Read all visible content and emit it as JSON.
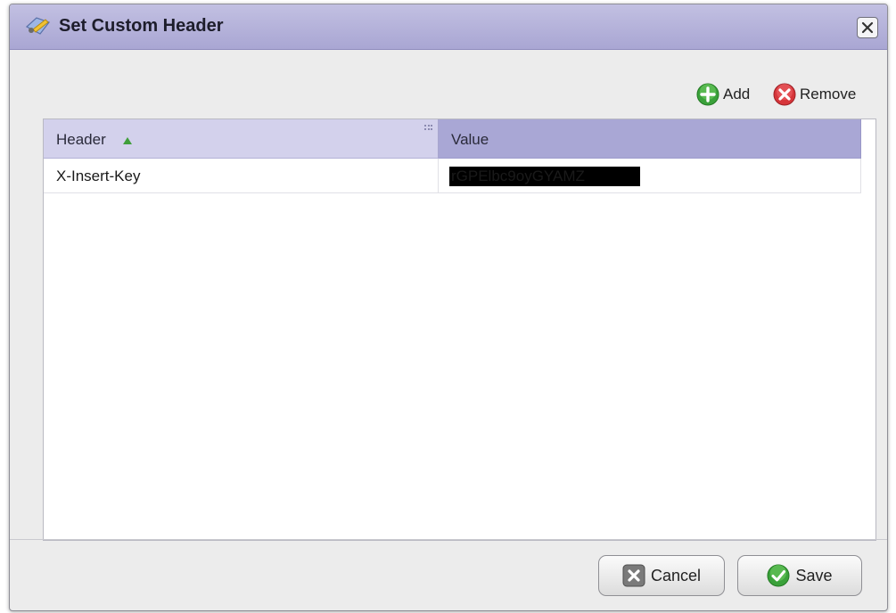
{
  "dialog": {
    "title": "Set Custom Header",
    "close_label": "close"
  },
  "toolbar": {
    "add_label": "Add",
    "remove_label": "Remove"
  },
  "grid": {
    "columns": [
      {
        "label": "Header",
        "sort": "ascending"
      },
      {
        "label": "Value"
      }
    ],
    "rows": [
      {
        "header": "X-Insert-Key",
        "value_visible_suffix": "rGPElbc9oyGYAMZ",
        "value_redacted": true
      }
    ]
  },
  "footer": {
    "cancel_label": "Cancel",
    "save_label": "Save"
  },
  "colors": {
    "titlebar": "#b3b0da",
    "header_column_bg": "#d3d1ec",
    "value_column_bg": "#a9a7d5",
    "add_icon": "#3aa13a",
    "remove_icon": "#d6353a",
    "save_icon": "#3aa13a"
  },
  "icons": {
    "title": "dialog-tools-icon",
    "add": "plus-circle-icon",
    "remove": "x-circle-icon",
    "cancel": "cancel-x-icon",
    "save": "checkmark-circle-icon",
    "sort": "sort-ascending-icon",
    "grip": "column-menu-grip-icon"
  }
}
